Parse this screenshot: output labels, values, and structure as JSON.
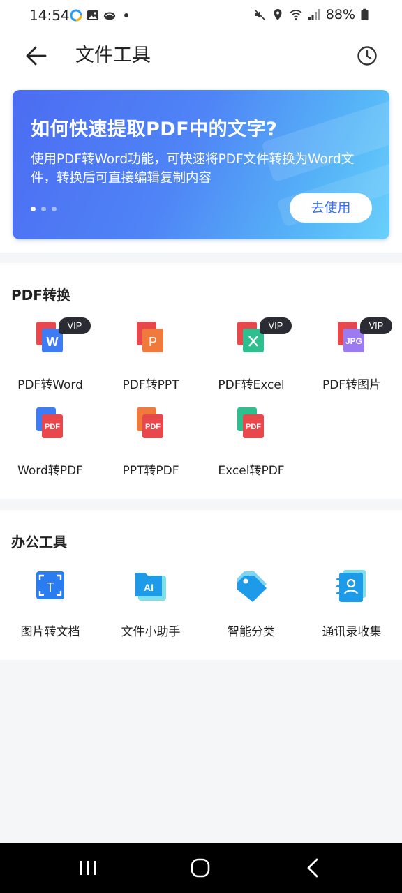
{
  "status_bar": {
    "time": "14:54",
    "battery": "88%"
  },
  "app_bar": {
    "title": "文件工具"
  },
  "banner": {
    "title": "如何快速提取PDF中的文字?",
    "description": "使用PDF转Word功能，可快速将PDF文件转换为Word文件，转换后可直接编辑复制内容",
    "button_label": "去使用",
    "pages": 3,
    "active_page": 1
  },
  "pdf_section": {
    "title": "PDF转换",
    "vip_label": "VIP",
    "tools": [
      {
        "label": "PDF转Word",
        "icon": "pdf-to-word-icon",
        "vip": true
      },
      {
        "label": "PDF转PPT",
        "icon": "pdf-to-ppt-icon",
        "vip": false
      },
      {
        "label": "PDF转Excel",
        "icon": "pdf-to-excel-icon",
        "vip": true
      },
      {
        "label": "PDF转图片",
        "icon": "pdf-to-image-icon",
        "vip": true
      },
      {
        "label": "Word转PDF",
        "icon": "word-to-pdf-icon",
        "vip": false
      },
      {
        "label": "PPT转PDF",
        "icon": "ppt-to-pdf-icon",
        "vip": false
      },
      {
        "label": "Excel转PDF",
        "icon": "excel-to-pdf-icon",
        "vip": false
      }
    ]
  },
  "office_section": {
    "title": "办公工具",
    "tools": [
      {
        "label": "图片转文档",
        "icon": "image-to-text-icon"
      },
      {
        "label": "文件小助手",
        "icon": "ai-assistant-icon"
      },
      {
        "label": "智能分类",
        "icon": "smart-tag-icon"
      },
      {
        "label": "通讯录收集",
        "icon": "contacts-icon"
      }
    ]
  },
  "colors": {
    "accent": "#3a6ff0",
    "word": "#3d7cf5",
    "ppt": "#f07a3b",
    "excel": "#2fbf8f",
    "pdf_red": "#e8474b"
  }
}
